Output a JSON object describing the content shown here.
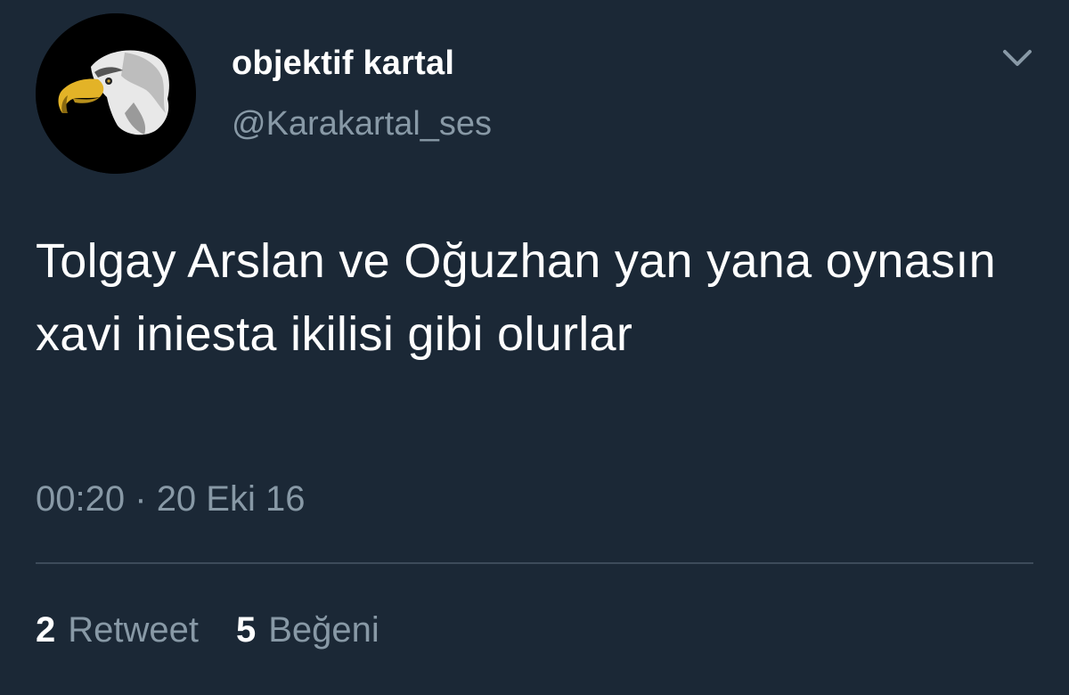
{
  "author": {
    "display_name": "objektif kartal",
    "handle": "@Karakartal_ses",
    "avatar_icon": "eagle-head"
  },
  "tweet": {
    "text": "Tolgay Arslan ve Oğuzhan yan yana oynasın xavi iniesta ikilisi gibi olurlar",
    "time": "00:20",
    "separator": "·",
    "date": "20 Eki 16"
  },
  "stats": {
    "retweets": {
      "count": "2",
      "label": "Retweet"
    },
    "likes": {
      "count": "5",
      "label": "Beğeni"
    }
  },
  "menu": {
    "icon": "chevron-down-icon"
  },
  "colors": {
    "background": "#1b2836",
    "text": "#ffffff",
    "muted": "#8899a6",
    "divider": "#3d4b5a"
  }
}
